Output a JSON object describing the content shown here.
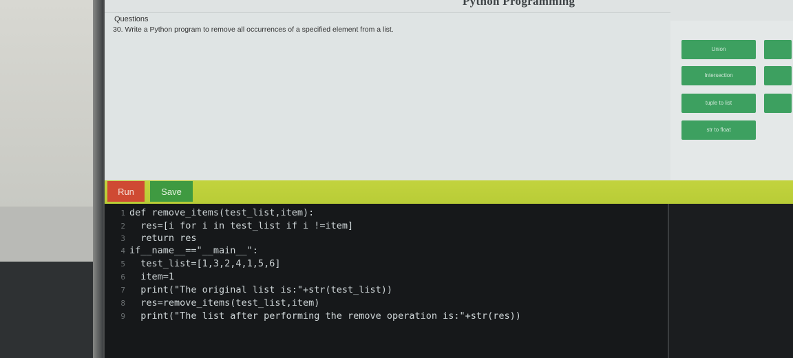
{
  "page_header": "Python Programming",
  "question": {
    "heading": "Questions",
    "text": "30. Write a Python program to remove all occurrences of a specified element from a list."
  },
  "side_buttons": [
    {
      "label": "Union"
    },
    {
      "label": "Intersection"
    },
    {
      "label": "tuple to list"
    },
    {
      "label": "str to float"
    }
  ],
  "toolbar": {
    "run_label": "Run",
    "save_label": "Save"
  },
  "code_lines": [
    {
      "num": "1",
      "text": "def remove_items(test_list,item):"
    },
    {
      "num": "2",
      "text": "  res=[i for i in test_list if i !=item]"
    },
    {
      "num": "3",
      "text": "  return res"
    },
    {
      "num": "4",
      "text": "if__name__==\"__main__\":"
    },
    {
      "num": "5",
      "text": "  test_list=[1,3,2,4,1,5,6]"
    },
    {
      "num": "6",
      "text": "  item=1"
    },
    {
      "num": "7",
      "text": "  print(\"The original list is:\"+str(test_list))"
    },
    {
      "num": "8",
      "text": "  res=remove_items(test_list,item)"
    },
    {
      "num": "9",
      "text": "  print(\"The list after performing the remove operation is:\"+str(res))"
    }
  ],
  "colors": {
    "run": "#cf4a33",
    "save": "#3f9a41",
    "toolbar": "#c2d33e",
    "side_button": "#2f9a55",
    "editor_bg": "#16181a"
  }
}
